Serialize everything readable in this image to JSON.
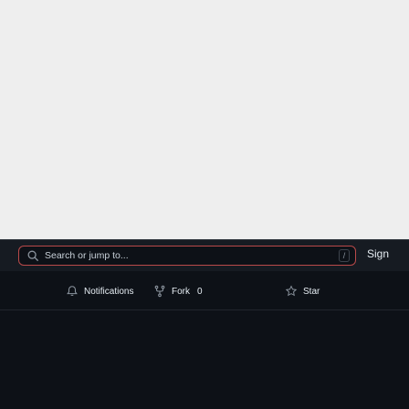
{
  "search": {
    "placeholder": "Search or jump to...",
    "shortcut": "/"
  },
  "header": {
    "sign_in_label": "Sign"
  },
  "repo_actions": {
    "notifications_label": "Notifications",
    "fork_label": "Fork",
    "fork_count": "0",
    "star_label": "Star"
  },
  "icons": {
    "search": "search-icon",
    "notifications": "bell-icon",
    "fork": "repo-forked-icon",
    "star": "star-icon"
  },
  "colors": {
    "header_bg": "#161b22",
    "page_bg": "#0d1117",
    "focus_border": "#b94a4a"
  }
}
